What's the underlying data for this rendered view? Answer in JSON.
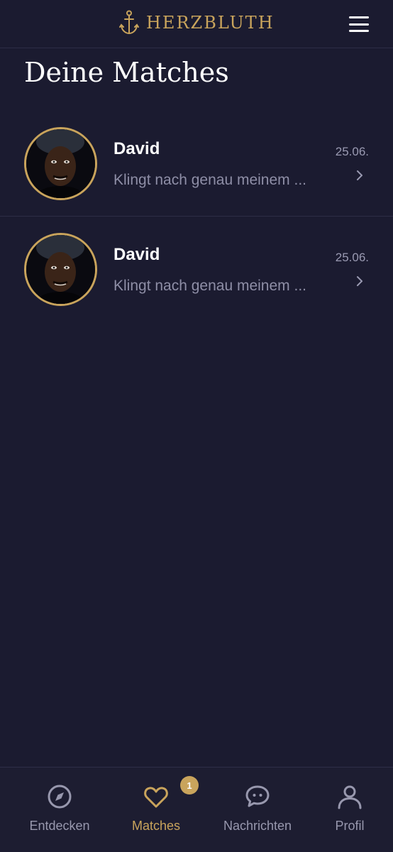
{
  "brand": {
    "name": "HERZBLUTH",
    "logo_icon": "anchor-icon",
    "accent_color": "#c9a45c"
  },
  "header": {
    "menu_icon": "hamburger-menu-icon"
  },
  "page": {
    "title": "Deine Matches"
  },
  "matches": [
    {
      "name": "David",
      "preview": "Klingt nach genau meinem ...",
      "date": "25.06."
    },
    {
      "name": "David",
      "preview": "Klingt nach genau meinem ...",
      "date": "25.06."
    }
  ],
  "nav": {
    "items": [
      {
        "label": "Entdecken",
        "icon": "compass-icon",
        "active": false
      },
      {
        "label": "Matches",
        "icon": "heart-icon",
        "active": true,
        "badge": "1"
      },
      {
        "label": "Nachrichten",
        "icon": "chat-bubble-icon",
        "active": false
      },
      {
        "label": "Profil",
        "icon": "user-icon",
        "active": false
      }
    ]
  }
}
